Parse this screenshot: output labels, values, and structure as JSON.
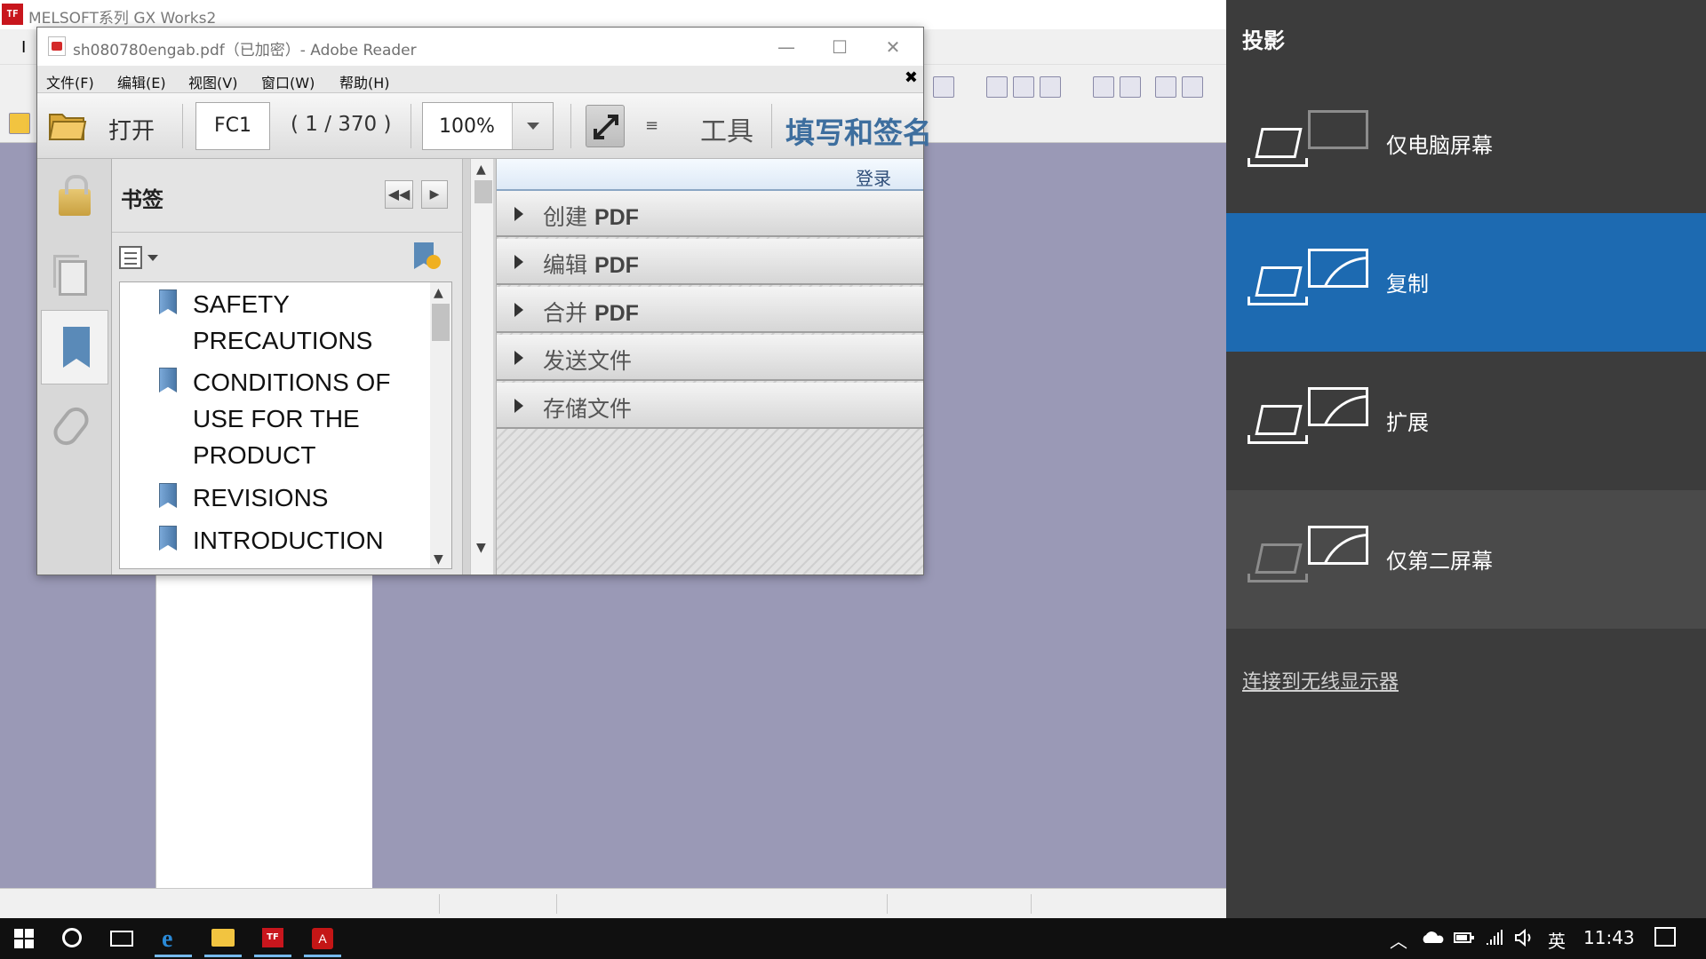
{
  "gx_works": {
    "title": "MELSOFT系列 GX Works2",
    "app_icon_text": "TF",
    "menu_stub": "I"
  },
  "reader": {
    "title": "sh080780engab.pdf（已加密）- Adobe Reader",
    "window_controls": {
      "minimize": "—",
      "maximize": "☐",
      "close": "✕"
    },
    "menu": [
      "文件(F)",
      "编辑(E)",
      "视图(V)",
      "窗口(W)",
      "帮助(H)"
    ],
    "close_doc": "✖",
    "toolbar": {
      "open_label": "打开",
      "page_value": "FC1",
      "page_count": "( 1 / 370 )",
      "zoom_value": "100%",
      "tools_label": "工具",
      "sign_label": "填写和签名"
    },
    "bookmarks": {
      "title": "书签",
      "collapse_btn": "◀◀",
      "next_btn": "▶",
      "items": [
        {
          "label": "SAFETY PRECAUTIONS"
        },
        {
          "label": "CONDITIONS OF USE FOR THE PRODUCT"
        },
        {
          "label": "REVISIONS"
        },
        {
          "label": "INTRODUCTION"
        }
      ],
      "scroll_up": "▲",
      "scroll_down": "▼"
    },
    "tools_pane": {
      "login": "登录",
      "rows": [
        {
          "prefix": "创建 ",
          "bold": "PDF"
        },
        {
          "prefix": "编辑 ",
          "bold": "PDF"
        },
        {
          "prefix": "合并 ",
          "bold": "PDF"
        },
        {
          "prefix": "发送文件",
          "bold": ""
        },
        {
          "prefix": "存储文件",
          "bold": ""
        }
      ]
    }
  },
  "project_panel": {
    "title": "投影",
    "options": [
      {
        "label": "仅电脑屏幕",
        "selected": false
      },
      {
        "label": "复制",
        "selected": true
      },
      {
        "label": "扩展",
        "selected": false
      },
      {
        "label": "仅第二屏幕",
        "selected": false
      }
    ],
    "connect_link": "连接到无线显示器",
    "selected_color": "#1d6ab1",
    "background_color": "#3c3c3c"
  },
  "taskbar": {
    "apps": [
      {
        "name": "internet-explorer",
        "icon": "e"
      },
      {
        "name": "file-explorer",
        "icon": "folder-icon"
      },
      {
        "name": "melsoft",
        "icon": "TF"
      },
      {
        "name": "acrobat",
        "icon": "A"
      }
    ],
    "tray": {
      "chevron": "︿",
      "ime": "英",
      "time": "11:43"
    }
  }
}
